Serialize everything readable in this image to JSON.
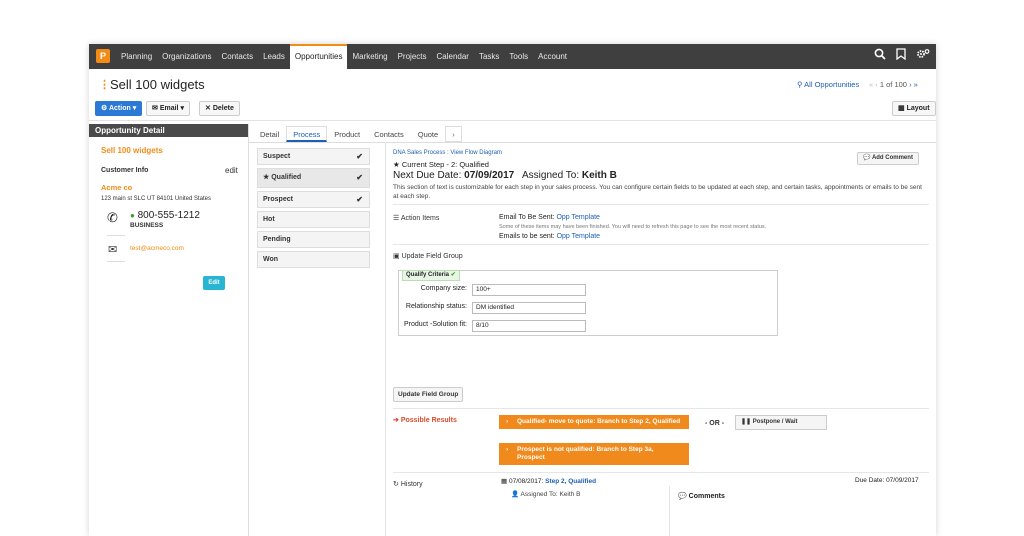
{
  "nav": {
    "logo": "P",
    "items": [
      "Planning",
      "Organizations",
      "Contacts",
      "Leads",
      "Opportunities",
      "Marketing",
      "Projects",
      "Calendar",
      "Tasks",
      "Tools",
      "Account"
    ],
    "active": "Opportunities"
  },
  "header": {
    "title": "Sell 100 widgets",
    "all_link": "All Opportunities",
    "pager_text": "1 of 100"
  },
  "toolbar": {
    "action": "Action",
    "email": "Email",
    "delete": "Delete",
    "layout": "Layout"
  },
  "detail": {
    "heading": "Opportunity Detail",
    "name": "Sell 100 widgets",
    "customer_info": "Customer Info",
    "edit_link": "edit",
    "company": "Acme co",
    "address": "123 main st SLC UT 84101 United States",
    "phone": "800-555-1212",
    "phone_type": "BUSINESS",
    "email": "test@acmeco.com",
    "edit_button": "Edit"
  },
  "tabs": [
    "Detail",
    "Process",
    "Product",
    "Contacts",
    "Quote"
  ],
  "steps": [
    {
      "label": "Suspect",
      "done": true
    },
    {
      "label": "Qualified",
      "done": true,
      "current": true
    },
    {
      "label": "Prospect",
      "done": true
    },
    {
      "label": "Hot",
      "done": false
    },
    {
      "label": "Pending",
      "done": false
    },
    {
      "label": "Won",
      "done": false
    }
  ],
  "process": {
    "flow_link": "DNA Sales Process : View Flow Diagram",
    "current_step": "Current Step - 2: Qualified",
    "next_due_prefix": "Next Due Date:",
    "next_due": "07/09/2017",
    "assigned_prefix": "Assigned To:",
    "assigned": "Keith B",
    "description": "This section of text is customizable for each step in your sales process. You can configure certain fields to be updated at each step, and certain tasks, appointments or emails to be sent at each step.",
    "add_comment": "Add Comment"
  },
  "action_items": {
    "label": "Action Items",
    "email_to_send_label": "Email To Be Sent:",
    "email_to_send": "Opp Template",
    "note": "Some of these items may have been finished. You will need to refresh this page to see the most recent status.",
    "emails_label": "Emails to be sent:",
    "emails": "Opp Template"
  },
  "field_group": {
    "label": "Update Field Group",
    "tag": "Qualify Criteria",
    "fields": [
      {
        "label": "Company size:",
        "value": "100+"
      },
      {
        "label": "Relationship status:",
        "value": "DM identified"
      },
      {
        "label": "Product -Solution fit:",
        "value": "8/10"
      }
    ],
    "button": "Update Field Group"
  },
  "results": {
    "label": "Possible Results",
    "options": [
      "Qualified- move to quote: Branch to Step 2, Qualified",
      "Prospect is not qualified: Branch to Step 3a, Prospect"
    ],
    "or": "- OR -",
    "postpone": "Postpone / Wait"
  },
  "history": {
    "label": "History",
    "date": "07/08/2017:",
    "step_link": "Step 2, Qualified",
    "due": "Due Date: 07/09/2017",
    "assigned": "Assigned To: Keith B",
    "comments": "Comments"
  },
  "colors": {
    "accent": "#f28c17",
    "nav_bg": "#3f3f3f",
    "link": "#1e5fb3",
    "primary_button": "#2a7ad5",
    "edit_button": "#28b5d4"
  }
}
